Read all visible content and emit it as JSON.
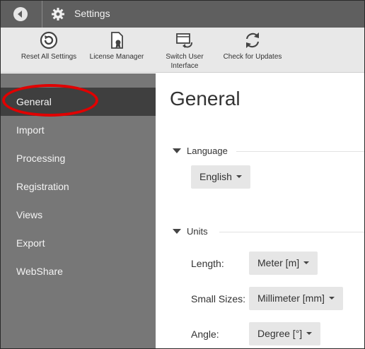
{
  "titlebar": {
    "title": "Settings"
  },
  "toolbar": {
    "reset": "Reset All Settings",
    "license": "License Manager",
    "switch_ui": "Switch User\nInterface",
    "updates": "Check for Updates"
  },
  "sidebar": {
    "items": [
      {
        "label": "General",
        "active": true
      },
      {
        "label": "Import"
      },
      {
        "label": "Processing"
      },
      {
        "label": "Registration"
      },
      {
        "label": "Views"
      },
      {
        "label": "Export"
      },
      {
        "label": "WebShare"
      }
    ]
  },
  "main": {
    "title": "General",
    "language": {
      "heading": "Language",
      "value": "English"
    },
    "units": {
      "heading": "Units",
      "length": {
        "label": "Length:",
        "value": "Meter [m]"
      },
      "small_sizes": {
        "label": "Small Sizes:",
        "value": "Millimeter [mm]"
      },
      "angle": {
        "label": "Angle:",
        "value": "Degree [°]"
      }
    }
  },
  "colors": {
    "titlebar": "#5f5f5f",
    "toolbar": "#e8e8e8",
    "sidebar": "#777777",
    "sidebar_active": "#3f3f3f",
    "highlight": "#e00000"
  }
}
